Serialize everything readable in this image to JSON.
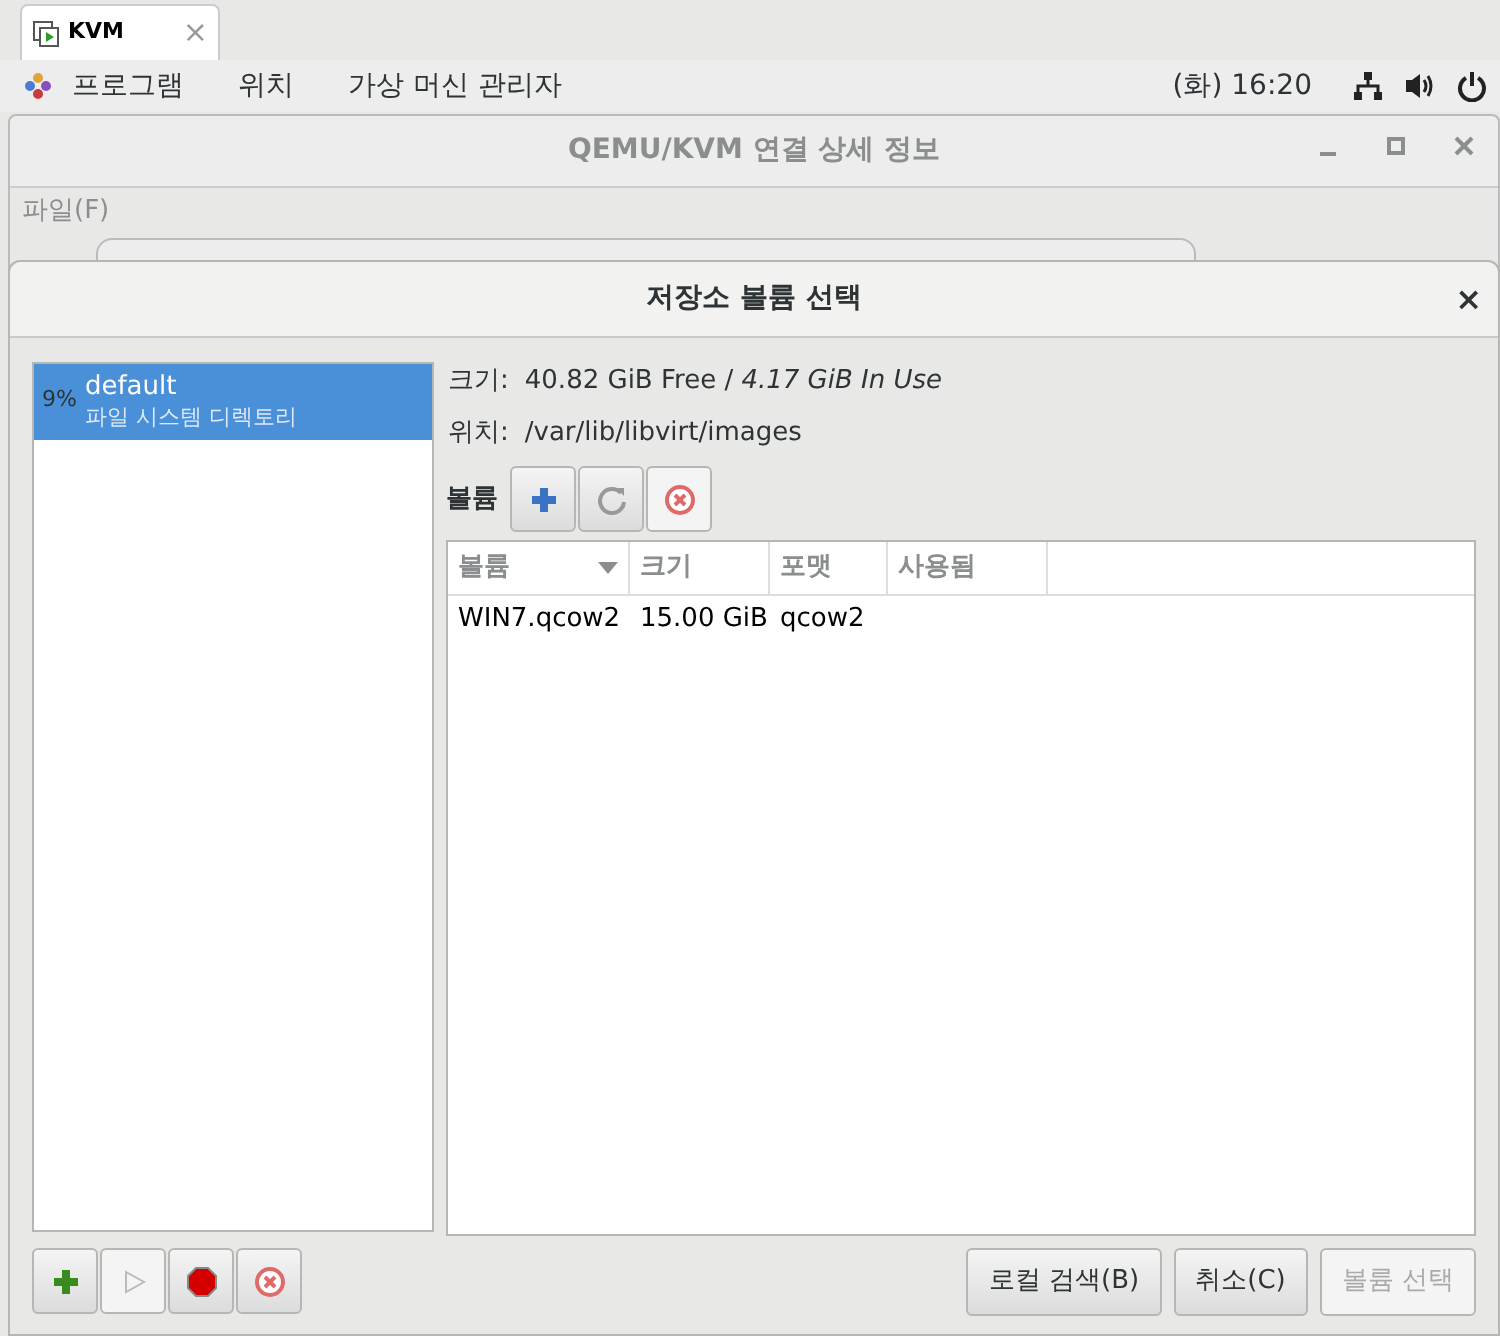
{
  "browser_tab": {
    "title": "KVM",
    "close": "×"
  },
  "top_panel": {
    "menus": [
      "프로그램",
      "위치",
      "가상 머신 관리자"
    ],
    "clock": "(화) 16:20"
  },
  "background_window": {
    "title": "QEMU/KVM 연결 상세 정보",
    "menu": "파일(F)"
  },
  "dialog": {
    "title": "저장소 볼륨 선택",
    "close": "×",
    "pools": [
      {
        "usage": "9%",
        "name": "default",
        "type": "파일 시스템 디렉토리",
        "selected": true
      }
    ],
    "size_label": "크기:",
    "size_free": "40.82 GiB Free",
    "size_sep": " / ",
    "size_in_use": "4.17 GiB In Use",
    "location_label": "위치:",
    "location": "/var/lib/libvirt/images",
    "volumes_label": "볼륨",
    "table": {
      "columns": [
        {
          "label": "볼륨",
          "sorted": true
        },
        {
          "label": "크기",
          "sorted": false
        },
        {
          "label": "포맷",
          "sorted": false
        },
        {
          "label": "사용됨",
          "sorted": false
        }
      ],
      "rows": [
        [
          "WIN7.qcow2",
          "15.00 GiB",
          "qcow2"
        ]
      ]
    },
    "pool_buttons": [
      {
        "kind": "add",
        "disabled": false
      },
      {
        "kind": "start",
        "disabled": true
      },
      {
        "kind": "stop",
        "disabled": false
      },
      {
        "kind": "delete",
        "disabled": false
      }
    ],
    "buttons": [
      {
        "label": "로컬 검색(B)",
        "disabled": false
      },
      {
        "label": "취소(C)",
        "disabled": false
      },
      {
        "label": "볼륨 선택",
        "disabled": true
      }
    ]
  }
}
